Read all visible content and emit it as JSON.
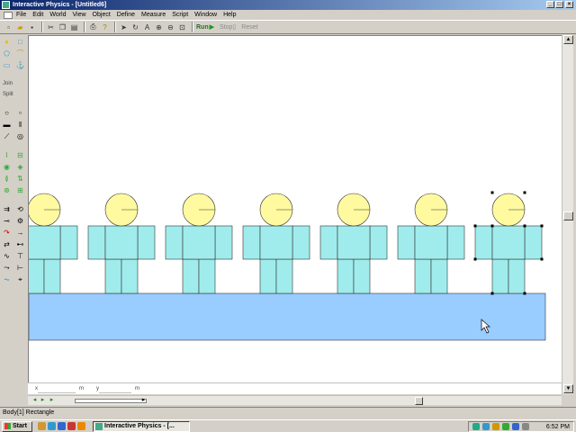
{
  "window": {
    "title": "Interactive Physics - [Untitled6]",
    "controls": [
      "_",
      "□",
      "×"
    ]
  },
  "menu": {
    "items": [
      "File",
      "Edit",
      "World",
      "View",
      "Object",
      "Define",
      "Measure",
      "Script",
      "Window",
      "Help"
    ]
  },
  "toolbar": {
    "icons": [
      "new-file-icon",
      "open-file-icon",
      "save-icon",
      "cut-icon",
      "copy-icon",
      "paste-icon",
      "print-icon",
      "help-icon",
      "arrow-tool-icon",
      "rotate-tool-icon",
      "text-tool-icon",
      "zoom-in-icon",
      "zoom-out-icon",
      "zoom-fit-icon"
    ],
    "run_label": "Run",
    "stop_label": "Stop",
    "reset_label": "Reset"
  },
  "palette": {
    "join_label": "Join",
    "split_label": "Split"
  },
  "scene": {
    "head_color": "#fffaa0",
    "body_color": "#a0ecec",
    "floor_color": "#99ccff",
    "stroke_color": "#333333"
  },
  "coords": {
    "x_label": "x",
    "x_unit": "m",
    "y_label": "y",
    "y_unit": "m"
  },
  "status": {
    "text": "Body[1] Rectangle"
  },
  "taskbar": {
    "start_label": "Start",
    "task_label": "Interactive Physics - [...",
    "clock": "6:52 PM"
  }
}
